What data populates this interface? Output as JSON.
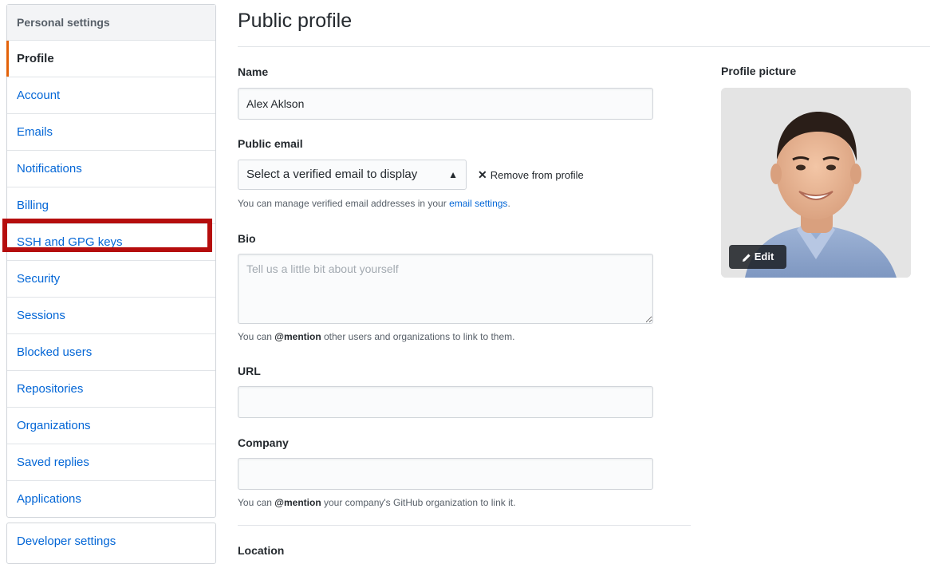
{
  "sidebar": {
    "heading": "Personal settings",
    "items": [
      {
        "label": "Profile"
      },
      {
        "label": "Account"
      },
      {
        "label": "Emails"
      },
      {
        "label": "Notifications"
      },
      {
        "label": "Billing"
      },
      {
        "label": "SSH and GPG keys"
      },
      {
        "label": "Security"
      },
      {
        "label": "Sessions"
      },
      {
        "label": "Blocked users"
      },
      {
        "label": "Repositories"
      },
      {
        "label": "Organizations"
      },
      {
        "label": "Saved replies"
      },
      {
        "label": "Applications"
      }
    ],
    "selected": "Profile",
    "highlighted": "SSH and GPG keys",
    "developer_settings": "Developer settings",
    "accent_color": "#e36209",
    "highlight_color": "#b50d0d"
  },
  "main": {
    "title": "Public profile",
    "name": {
      "label": "Name",
      "value": "Alex Aklson"
    },
    "public_email": {
      "label": "Public email",
      "selected": "Select a verified email to display",
      "remove_label": "Remove from profile",
      "note_prefix": "You can manage verified email addresses in your",
      "note_link": "email settings",
      "note_suffix": "."
    },
    "bio": {
      "label": "Bio",
      "placeholder": "Tell us a little bit about yourself",
      "note_prefix": "You can",
      "note_mention": "@mention",
      "note_suffix": "other users and organizations to link to them."
    },
    "url": {
      "label": "URL",
      "value": ""
    },
    "company": {
      "label": "Company",
      "value": "",
      "note_prefix": "You can",
      "note_mention": "@mention",
      "note_suffix": "your company's GitHub organization to link it."
    },
    "location": {
      "label": "Location"
    }
  },
  "profile_picture": {
    "label": "Profile picture",
    "edit_label": "Edit"
  },
  "colors": {
    "link": "#0366d6",
    "text": "#24292e"
  }
}
